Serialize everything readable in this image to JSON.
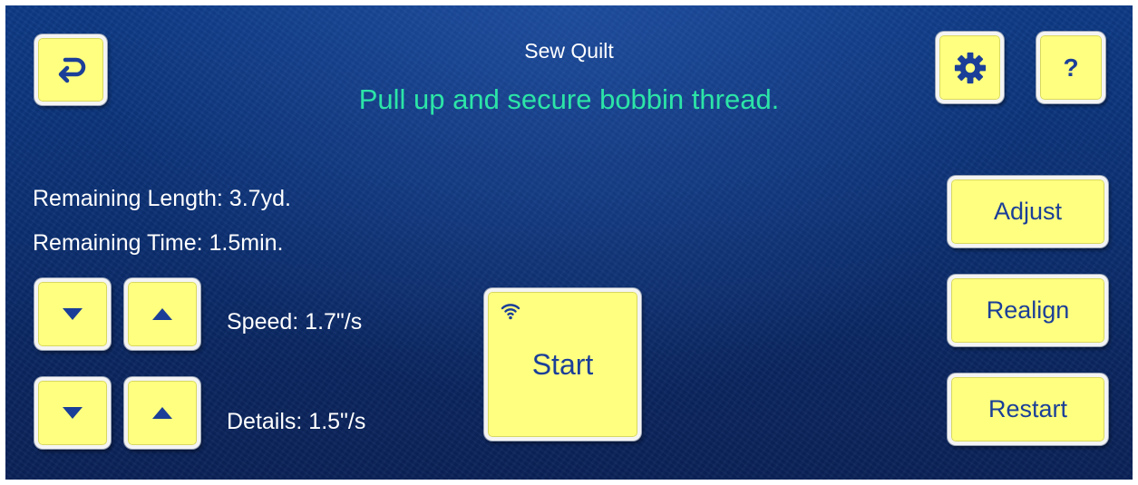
{
  "header": {
    "title": "Sew Quilt",
    "message": "Pull up and secure bobbin thread.",
    "help_label": "?"
  },
  "icons": {
    "back": "return-arrow-icon",
    "settings": "gear-icon",
    "wireless": "wifi-icon",
    "decrease": "triangle-down-icon",
    "increase": "triangle-up-icon"
  },
  "status": {
    "remaining_length": "Remaining Length: 3.7yd.",
    "remaining_time": "Remaining Time: 1.5min."
  },
  "controls": {
    "speed_label": "Speed: 1.7\"/s",
    "details_label": "Details: 1.5\"/s"
  },
  "main": {
    "start_label": "Start"
  },
  "side_buttons": {
    "adjust_label": "Adjust",
    "realign_label": "Realign",
    "restart_label": "Restart"
  },
  "colors": {
    "background": "#0b2f72",
    "button_fill": "#ffff80",
    "button_text": "#1b3f98",
    "message_text": "#2ce5a7",
    "label_text": "#ffffff"
  }
}
